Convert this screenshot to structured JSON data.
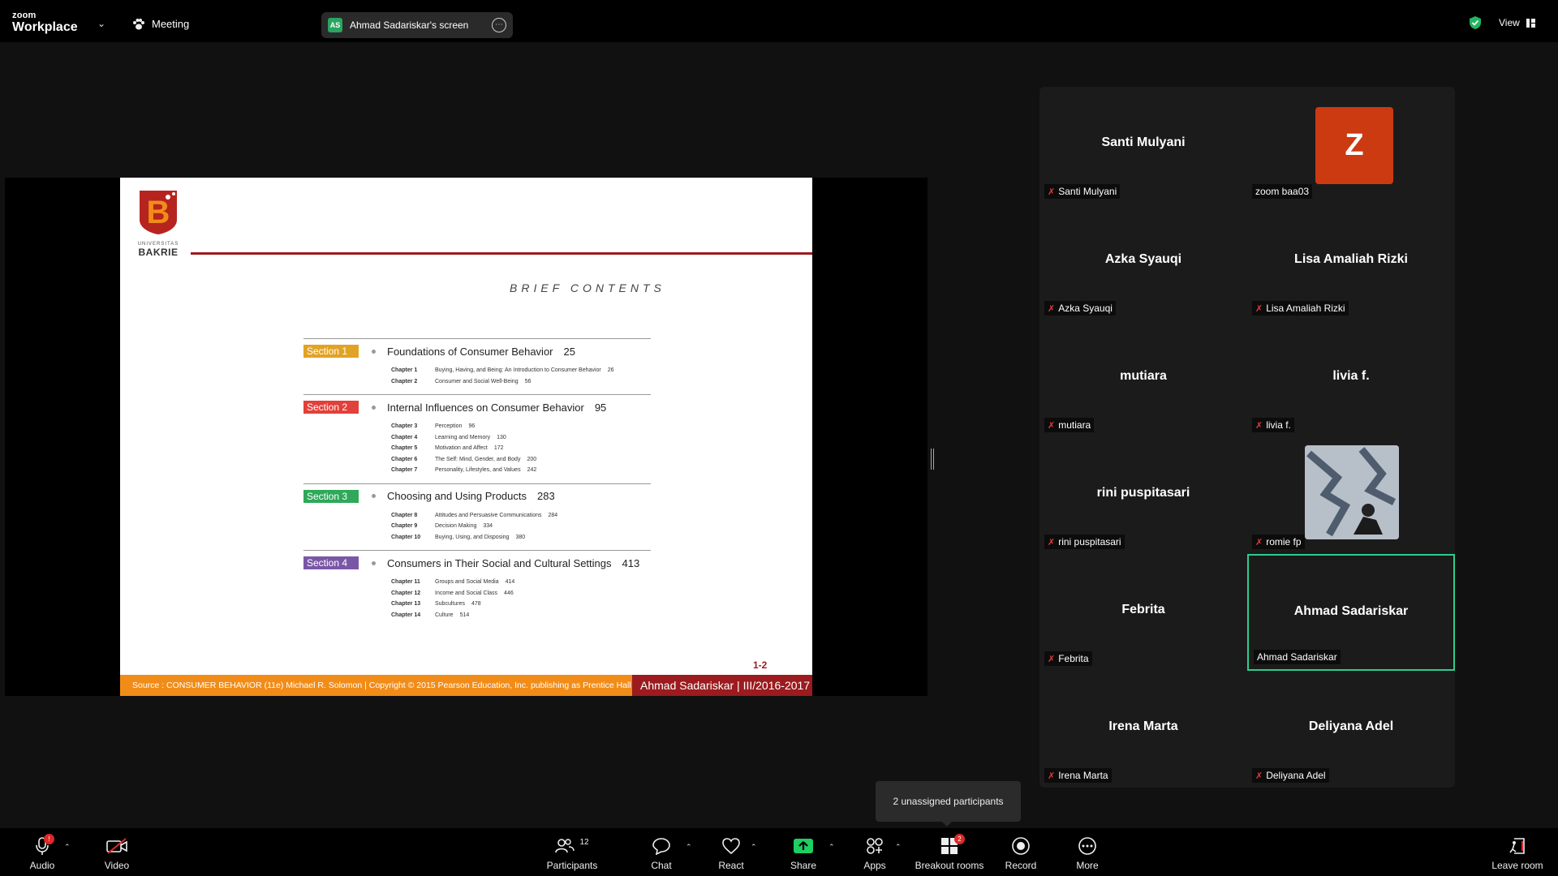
{
  "app": {
    "brand_small": "zoom",
    "brand_name": "Workplace",
    "meeting_label": "Meeting",
    "view_label": "View"
  },
  "screen_share": {
    "initials": "AS",
    "title": "Ahmad Sadariskar's screen"
  },
  "slide": {
    "logo_letter": "B",
    "logo_univ": "UNIVERSITAS",
    "logo_name": "BAKRIE",
    "heading": "BRIEF CONTENTS",
    "sections": [
      {
        "tag": "Section 1",
        "color": "#e2a325",
        "title": "Foundations of Consumer Behavior",
        "page": "25",
        "chapters": [
          {
            "num": "Chapter 1",
            "title": "Buying, Having, and Being: An Introduction to Consumer Behavior",
            "page": "26"
          },
          {
            "num": "Chapter 2",
            "title": "Consumer and Social Well-Being",
            "page": "56"
          }
        ]
      },
      {
        "tag": "Section 2",
        "color": "#e2403a",
        "title": "Internal Influences on Consumer Behavior",
        "page": "95",
        "chapters": [
          {
            "num": "Chapter 3",
            "title": "Perception",
            "page": "96"
          },
          {
            "num": "Chapter 4",
            "title": "Learning and Memory",
            "page": "130"
          },
          {
            "num": "Chapter 5",
            "title": "Motivation and Affect",
            "page": "172"
          },
          {
            "num": "Chapter 6",
            "title": "The Self: Mind, Gender, and Body",
            "page": "200"
          },
          {
            "num": "Chapter 7",
            "title": "Personality, Lifestyles, and Values",
            "page": "242"
          }
        ]
      },
      {
        "tag": "Section 3",
        "color": "#2fa85a",
        "title": "Choosing and Using Products",
        "page": "283",
        "chapters": [
          {
            "num": "Chapter 8",
            "title": "Attitudes and Persuasive Communications",
            "page": "284"
          },
          {
            "num": "Chapter 9",
            "title": "Decision Making",
            "page": "334"
          },
          {
            "num": "Chapter 10",
            "title": "Buying, Using, and Disposing",
            "page": "380"
          }
        ]
      },
      {
        "tag": "Section 4",
        "color": "#7a57a6",
        "title": "Consumers in Their Social and Cultural Settings",
        "page": "413",
        "chapters": [
          {
            "num": "Chapter 11",
            "title": "Groups and Social Media",
            "page": "414"
          },
          {
            "num": "Chapter 12",
            "title": "Income and Social Class",
            "page": "446"
          },
          {
            "num": "Chapter 13",
            "title": "Subcultures",
            "page": "478"
          },
          {
            "num": "Chapter 14",
            "title": "Culture",
            "page": "514"
          }
        ]
      }
    ],
    "slide_number": "1-2",
    "footer_source": "Source : CONSUMER BEHAVIOR (11e)  Michael R. Solomon | Copyright © 2015 Pearson Education, Inc. publishing as Prentice Hall",
    "footer_author": "Ahmad Sadariskar | III/2016-2017"
  },
  "participants": [
    {
      "display": "Santi Mulyani",
      "label": "Santi Mulyani",
      "muted": true
    },
    {
      "display": "Z",
      "label": "zoom baa03",
      "muted": false,
      "avatar": "letter"
    },
    {
      "display": "Azka Syauqi",
      "label": "Azka Syauqi",
      "muted": true
    },
    {
      "display": "Lisa Amaliah Rizki",
      "label": "Lisa Amaliah Rizki",
      "muted": true
    },
    {
      "display": "mutiara",
      "label": "mutiara",
      "muted": true
    },
    {
      "display": "livia f.",
      "label": "livia f.",
      "muted": true
    },
    {
      "display": "rini puspitasari",
      "label": "rini puspitasari",
      "muted": true
    },
    {
      "display": "",
      "label": "romie fp",
      "muted": true,
      "avatar": "photo"
    },
    {
      "display": "Febrita",
      "label": "Febrita",
      "muted": true
    },
    {
      "display": "Ahmad Sadariskar",
      "label": "Ahmad Sadariskar",
      "muted": false,
      "active": true
    },
    {
      "display": "Irena Marta",
      "label": "Irena Marta",
      "muted": true
    },
    {
      "display": "Deliyana Adel",
      "label": "Deliyana Adel",
      "muted": true
    }
  ],
  "tooltip": "2 unassigned participants",
  "toolbar": {
    "audio": "Audio",
    "video": "Video",
    "participants": "Participants",
    "participants_count": "12",
    "chat": "Chat",
    "react": "React",
    "share": "Share",
    "apps": "Apps",
    "breakout": "Breakout rooms",
    "breakout_badge": "2",
    "record": "Record",
    "more": "More",
    "leave": "Leave room"
  }
}
